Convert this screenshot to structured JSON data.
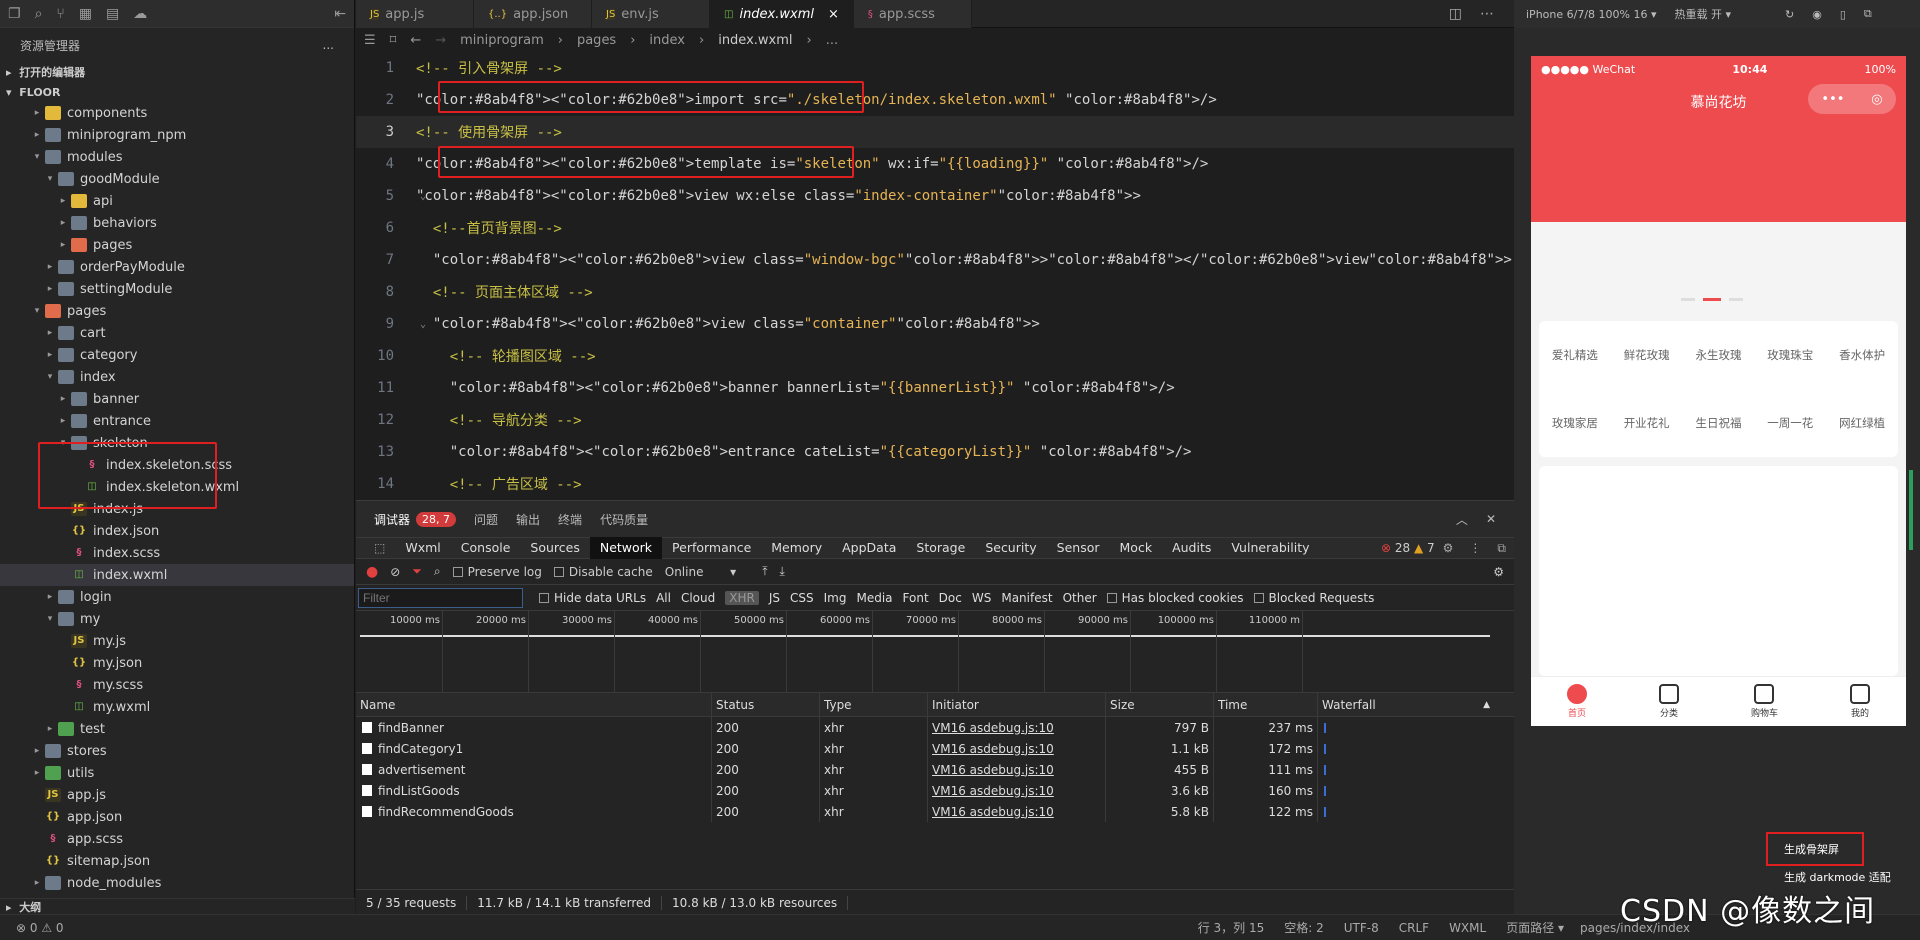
{
  "explorer": {
    "title": "资源管理器",
    "more": "...",
    "open_editors": "打开的编辑器",
    "project": "FLOOR",
    "outline": "大纲",
    "tree": [
      {
        "label": "components",
        "depth": 1,
        "kind": "folder-y",
        "arrow": "▸"
      },
      {
        "label": "miniprogram_npm",
        "depth": 1,
        "kind": "folder",
        "arrow": "▸"
      },
      {
        "label": "modules",
        "depth": 1,
        "kind": "folder",
        "arrow": "▾"
      },
      {
        "label": "goodModule",
        "depth": 2,
        "kind": "folder",
        "arrow": "▾"
      },
      {
        "label": "api",
        "depth": 3,
        "kind": "folder-y",
        "arrow": "▸"
      },
      {
        "label": "behaviors",
        "depth": 3,
        "kind": "folder",
        "arrow": "▸"
      },
      {
        "label": "pages",
        "depth": 3,
        "kind": "folder-o",
        "arrow": "▸"
      },
      {
        "label": "orderPayModule",
        "depth": 2,
        "kind": "folder",
        "arrow": "▸"
      },
      {
        "label": "settingModule",
        "depth": 2,
        "kind": "folder",
        "arrow": "▸"
      },
      {
        "label": "pages",
        "depth": 1,
        "kind": "folder-o",
        "arrow": "▾"
      },
      {
        "label": "cart",
        "depth": 2,
        "kind": "folder",
        "arrow": "▸"
      },
      {
        "label": "category",
        "depth": 2,
        "kind": "folder",
        "arrow": "▸"
      },
      {
        "label": "index",
        "depth": 2,
        "kind": "folder",
        "arrow": "▾"
      },
      {
        "label": "banner",
        "depth": 3,
        "kind": "folder",
        "arrow": "▸"
      },
      {
        "label": "entrance",
        "depth": 3,
        "kind": "folder",
        "arrow": "▸"
      },
      {
        "label": "skeleton",
        "depth": 3,
        "kind": "folder",
        "arrow": "▾"
      },
      {
        "label": "index.skeleton.scss",
        "depth": 4,
        "kind": "scss",
        "arrow": ""
      },
      {
        "label": "index.skeleton.wxml",
        "depth": 4,
        "kind": "wxml",
        "arrow": ""
      },
      {
        "label": "index.js",
        "depth": 3,
        "kind": "js",
        "arrow": ""
      },
      {
        "label": "index.json",
        "depth": 3,
        "kind": "json",
        "arrow": ""
      },
      {
        "label": "index.scss",
        "depth": 3,
        "kind": "scss",
        "arrow": ""
      },
      {
        "label": "index.wxml",
        "depth": 3,
        "kind": "wxml",
        "arrow": "",
        "selected": true
      },
      {
        "label": "login",
        "depth": 2,
        "kind": "folder",
        "arrow": "▸"
      },
      {
        "label": "my",
        "depth": 2,
        "kind": "folder",
        "arrow": "▾"
      },
      {
        "label": "my.js",
        "depth": 3,
        "kind": "js",
        "arrow": ""
      },
      {
        "label": "my.json",
        "depth": 3,
        "kind": "json",
        "arrow": ""
      },
      {
        "label": "my.scss",
        "depth": 3,
        "kind": "scss",
        "arrow": ""
      },
      {
        "label": "my.wxml",
        "depth": 3,
        "kind": "wxml",
        "arrow": ""
      },
      {
        "label": "test",
        "depth": 2,
        "kind": "folder-g",
        "arrow": "▸"
      },
      {
        "label": "stores",
        "depth": 1,
        "kind": "folder",
        "arrow": "▸"
      },
      {
        "label": "utils",
        "depth": 1,
        "kind": "folder-g",
        "arrow": "▸"
      },
      {
        "label": "app.js",
        "depth": 1,
        "kind": "js",
        "arrow": ""
      },
      {
        "label": "app.json",
        "depth": 1,
        "kind": "json",
        "arrow": ""
      },
      {
        "label": "app.scss",
        "depth": 1,
        "kind": "scss",
        "arrow": ""
      },
      {
        "label": "sitemap.json",
        "depth": 1,
        "kind": "json",
        "arrow": ""
      },
      {
        "label": "node_modules",
        "depth": 1,
        "kind": "folder",
        "arrow": "▸"
      }
    ]
  },
  "tabs": [
    {
      "label": "app.js",
      "icon": "JS",
      "kind": "js"
    },
    {
      "label": "app.json",
      "icon": "{..}",
      "kind": "json"
    },
    {
      "label": "env.js",
      "icon": "JS",
      "kind": "js"
    },
    {
      "label": "index.wxml",
      "icon": "◫",
      "kind": "wxml",
      "active": true,
      "close": "×"
    },
    {
      "label": "app.scss",
      "icon": "§",
      "kind": "scss"
    }
  ],
  "breadcrumb": [
    "miniprogram",
    "pages",
    "index",
    "index.wxml",
    "..."
  ],
  "code": [
    {
      "n": "1",
      "text": "<!-- 引入骨架屏 -->"
    },
    {
      "n": "2",
      "text": "<import src=\"./skeleton/index.skeleton.wxml\" />"
    },
    {
      "n": "3",
      "text": "<!-- 使用骨架屏 -->"
    },
    {
      "n": "4",
      "text": "<template is=\"skeleton\" wx:if=\"{{loading}}\" />"
    },
    {
      "n": "5",
      "text": "<view wx:else class=\"index-container\">"
    },
    {
      "n": "6",
      "text": "  <!--首页背景图-->"
    },
    {
      "n": "7",
      "text": "  <view class=\"window-bgc\"></view>"
    },
    {
      "n": "8",
      "text": "  <!-- 页面主体区域 -->"
    },
    {
      "n": "9",
      "text": "  <view class=\"container\">"
    },
    {
      "n": "10",
      "text": "    <!-- 轮播图区域 -->"
    },
    {
      "n": "11",
      "text": "    <banner bannerList=\"{{bannerList}}\" />"
    },
    {
      "n": "12",
      "text": "    <!-- 导航分类 -->"
    },
    {
      "n": "13",
      "text": "    <entrance cateList=\"{{categoryList}}\" />"
    },
    {
      "n": "14",
      "text": "    <!-- 广告区域 -->"
    }
  ],
  "devtools": {
    "panel_tabs": [
      "调试器",
      "问题",
      "输出",
      "终端",
      "代码质量"
    ],
    "badge": "28, 7",
    "tabs": [
      "Wxml",
      "Console",
      "Sources",
      "Network",
      "Performance",
      "Memory",
      "AppData",
      "Storage",
      "Security",
      "Sensor",
      "Mock",
      "Audits",
      "Vulnerability"
    ],
    "active_tab": "Network",
    "errors": "28",
    "warnings": "7",
    "preserve_log": "Preserve log",
    "disable_cache": "Disable cache",
    "throttle": "Online",
    "filter_placeholder": "Filter",
    "hide_data_urls": "Hide data URLs",
    "types": [
      "All",
      "Cloud",
      "XHR",
      "JS",
      "CSS",
      "Img",
      "Media",
      "Font",
      "Doc",
      "WS",
      "Manifest",
      "Other"
    ],
    "has_blocked": "Has blocked cookies",
    "blocked_requests": "Blocked Requests",
    "ticks": [
      "10000 ms",
      "20000 ms",
      "30000 ms",
      "40000 ms",
      "50000 ms",
      "60000 ms",
      "70000 ms",
      "80000 ms",
      "90000 ms",
      "100000 ms",
      "110000 m"
    ],
    "columns": [
      "Name",
      "Status",
      "Type",
      "Initiator",
      "Size",
      "Time",
      "Waterfall"
    ],
    "rows": [
      {
        "name": "findBanner",
        "status": "200",
        "type": "xhr",
        "initiator": "VM16 asdebug.js:10",
        "size": "797 B",
        "time": "237 ms"
      },
      {
        "name": "findCategory1",
        "status": "200",
        "type": "xhr",
        "initiator": "VM16 asdebug.js:10",
        "size": "1.1 kB",
        "time": "172 ms"
      },
      {
        "name": "advertisement",
        "status": "200",
        "type": "xhr",
        "initiator": "VM16 asdebug.js:10",
        "size": "455 B",
        "time": "111 ms"
      },
      {
        "name": "findListGoods",
        "status": "200",
        "type": "xhr",
        "initiator": "VM16 asdebug.js:10",
        "size": "3.6 kB",
        "time": "160 ms"
      },
      {
        "name": "findRecommendGoods",
        "status": "200",
        "type": "xhr",
        "initiator": "VM16 asdebug.js:10",
        "size": "5.8 kB",
        "time": "122 ms"
      }
    ],
    "summary": [
      "5 / 35 requests",
      "11.7 kB / 14.1 kB transferred",
      "10.8 kB / 13.0 kB resources"
    ]
  },
  "simulator": {
    "device": "iPhone 6/7/8 100% 16 ▾",
    "hotreload": "热重载 开 ▾",
    "carrier": "●●●●● WeChat",
    "time": "10:44",
    "battery": "100%",
    "title": "慕尚花坊",
    "cats_row1": [
      "爱礼精选",
      "鲜花玫瑰",
      "永生玫瑰",
      "玫瑰珠宝",
      "香水体护"
    ],
    "cats_row2": [
      "玫瑰家居",
      "开业花礼",
      "生日祝福",
      "一周一花",
      "网红绿植"
    ],
    "tabbar": [
      "首页",
      "分类",
      "购物车",
      "我的"
    ],
    "menu": [
      "生成骨架屏",
      "生成 darkmode 适配"
    ]
  },
  "status": {
    "errors": "⊗ 0 ⚠ 0",
    "position": "行 3，列 15",
    "spaces": "空格: 2",
    "encoding": "UTF-8",
    "eol": "CRLF",
    "lang": "WXML",
    "page_path_label": "页面路径 ▾",
    "page_path": "pages/index/index"
  },
  "watermark": "CSDN @像数之间"
}
